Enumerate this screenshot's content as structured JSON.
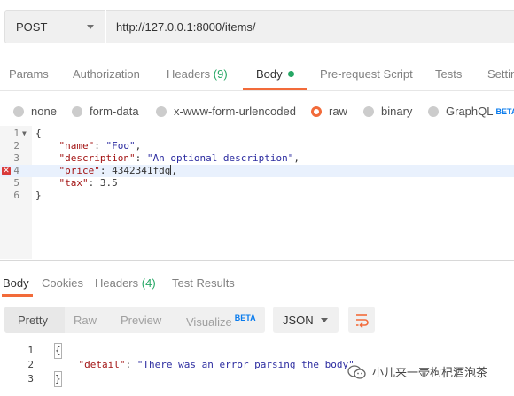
{
  "request": {
    "method": "POST",
    "url": "http://127.0.0.1:8000/items/"
  },
  "request_tabs": [
    {
      "label": "Params"
    },
    {
      "label": "Authorization"
    },
    {
      "label": "Headers",
      "count": "(9)"
    },
    {
      "label": "Body"
    },
    {
      "label": "Pre-request Script"
    },
    {
      "label": "Tests"
    },
    {
      "label": "Settin"
    }
  ],
  "body_modes": {
    "none": "none",
    "form_data": "form-data",
    "urlencoded": "x-www-form-urlencoded",
    "raw": "raw",
    "binary": "binary",
    "graphql": "GraphQL",
    "beta": "BETA",
    "selected": "raw"
  },
  "editor": {
    "line_numbers": [
      "1",
      "2",
      "3",
      "4",
      "5",
      "6"
    ],
    "lines": {
      "l1": "{",
      "l2_key": "\"name\"",
      "l2_val": "\"Foo\"",
      "l3_key": "\"description\"",
      "l3_val": "\"An optional description\"",
      "l4_key": "\"price\"",
      "l4_val": "4342341fdg",
      "l5_key": "\"tax\"",
      "l5_val": "3.5",
      "l6": "}"
    },
    "error_line": "4"
  },
  "response_tabs": {
    "body": "Body",
    "cookies": "Cookies",
    "headers": "Headers",
    "headers_count": "(4)",
    "test_results": "Test Results"
  },
  "response_view": {
    "pretty": "Pretty",
    "raw": "Raw",
    "preview": "Preview",
    "visualize": "Visualize",
    "beta": "BETA",
    "format": "JSON"
  },
  "response_body": {
    "line_numbers": [
      "1",
      "2",
      "3"
    ],
    "l1": "{",
    "l2_key": "\"detail\"",
    "l2_val": "\"There was an error parsing the body\"",
    "l3": "}"
  },
  "watermark": "小儿来一壶枸杞酒泡茶",
  "colors": {
    "accent": "#f26b3a",
    "success": "#26a765",
    "beta": "#097bed",
    "error": "#d93a3a"
  }
}
